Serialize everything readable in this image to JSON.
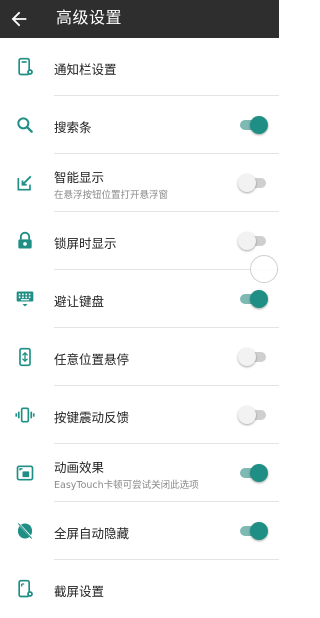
{
  "topbar": {
    "title": "高级设置",
    "back_icon": "arrow-left-icon"
  },
  "colors": {
    "accent": "#1f8f86",
    "topbar": "#2e2e2e"
  },
  "settings": [
    {
      "label": "通知栏设置",
      "subtitle": "",
      "icon": "notification-settings-icon",
      "toggle": null
    },
    {
      "label": "搜索条",
      "subtitle": "",
      "icon": "search-icon",
      "toggle": true
    },
    {
      "label": "智能显示",
      "subtitle": "在悬浮按钮位置打开悬浮窗",
      "icon": "smart-display-icon",
      "toggle": false
    },
    {
      "label": "锁屏时显示",
      "subtitle": "",
      "icon": "lock-icon",
      "toggle": false
    },
    {
      "label": "避让键盘",
      "subtitle": "",
      "icon": "keyboard-icon",
      "toggle": true
    },
    {
      "label": "任意位置悬停",
      "subtitle": "",
      "icon": "phone-hover-icon",
      "toggle": false
    },
    {
      "label": "按键震动反馈",
      "subtitle": "",
      "icon": "vibration-icon",
      "toggle": false
    },
    {
      "label": "动画效果",
      "subtitle": "EasyTouch卡顿可尝试关闭此选项",
      "icon": "animation-icon",
      "toggle": true
    },
    {
      "label": "全屏自动隐藏",
      "subtitle": "",
      "icon": "fullscreen-hide-icon",
      "toggle": true
    },
    {
      "label": "截屏设置",
      "subtitle": "",
      "icon": "screenshot-settings-icon",
      "toggle": null
    }
  ]
}
